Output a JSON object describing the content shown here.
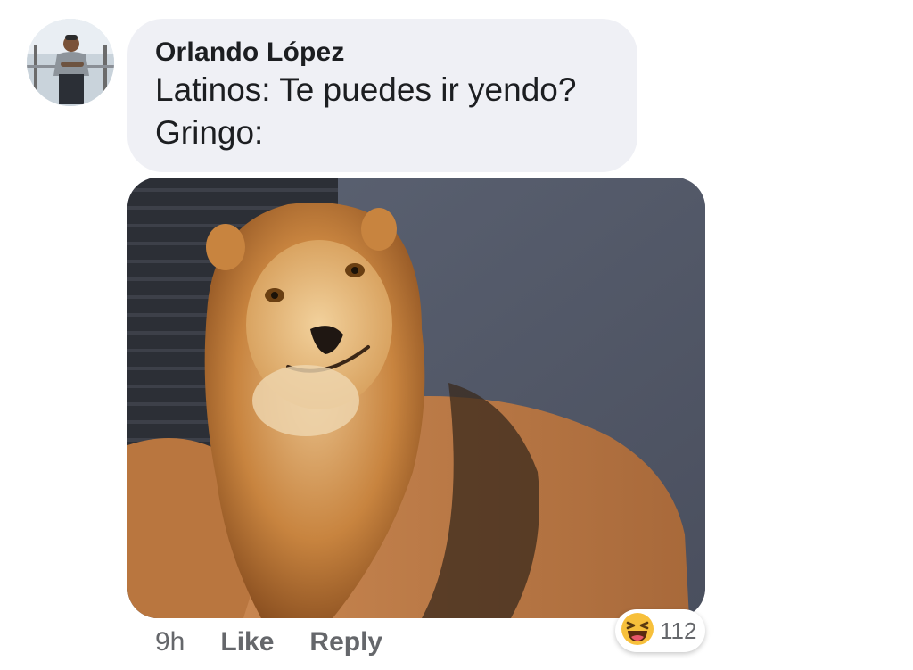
{
  "comment": {
    "author": "Orlando López",
    "lines": [
      "Latinos: Te puedes ir yendo?",
      "Gringo:"
    ],
    "time": "9h",
    "like_label": "Like",
    "reply_label": "Reply",
    "reactions": {
      "icon": "haha-reaction-icon",
      "count": "112"
    }
  },
  "colors": {
    "bubble_bg": "#eff0f5",
    "text": "#1c1e21",
    "meta_text": "#65676b",
    "haha_yellow": "#f7c03b"
  }
}
